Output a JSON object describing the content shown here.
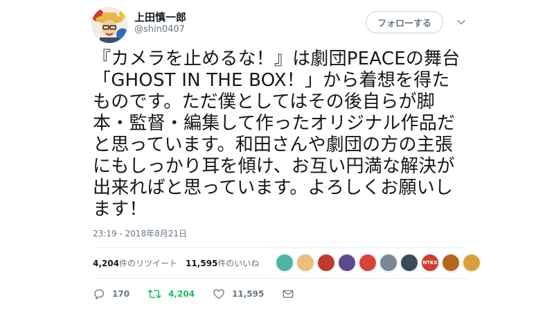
{
  "author": {
    "display_name": "上田慎一郎",
    "handle": "@shin0407"
  },
  "follow_button": {
    "label": "フォローする"
  },
  "tweet": {
    "text": "『カメラを止めるな！』は劇団PEACEの舞台\n「GHOST IN THE BOX！」から着想を得た\nものです。ただ僕としてはその後自らが脚\n本・監督・編集して作ったオリジナル作品だ\nと思っています。和田さんや劇団の方の主張\nにもしっかり耳を傾け、お互い円満な解決が\n出来ればと思っています。よろしくお願いし\nます！",
    "timestamp": "23:19 - 2018年8月21日"
  },
  "stats": {
    "retweets_count": "4,204",
    "retweets_label": "件のリツイート",
    "likes_count": "11,595",
    "likes_label": "件のいいね"
  },
  "liker_avatars": [
    {
      "color": "#4fb3a6"
    },
    {
      "color": "#e8c07a"
    },
    {
      "color": "#c0392b"
    },
    {
      "color": "#5b4b8a"
    },
    {
      "color": "#d9443a"
    },
    {
      "color": "#7a8894"
    },
    {
      "color": "#3a4a5a"
    },
    {
      "color": "#c8402e",
      "text": "NTKS"
    },
    {
      "color": "#b3661f"
    },
    {
      "color": "#d6a13a"
    }
  ],
  "actions": {
    "reply_count": "170",
    "retweet_count": "4,204",
    "like_count": "11,595"
  },
  "colors": {
    "retweet_green": "#17bf63",
    "secondary_text": "#657786",
    "divider": "#e6ecf0"
  }
}
